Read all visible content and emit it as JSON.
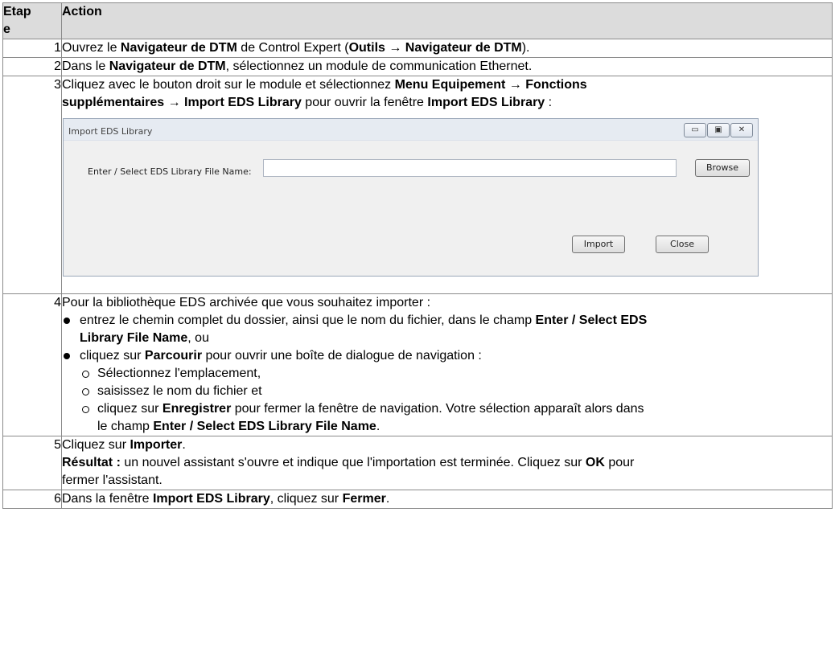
{
  "header": {
    "col1": "Etap",
    "col1b": "e",
    "col2": "Action"
  },
  "steps": [
    {
      "num": "1",
      "p1": "Ouvrez le ",
      "b1": "Navigateur de DTM",
      "p2": " de Control Expert (",
      "b2": "Outils → Navigateur de DTM",
      "p3": ")."
    },
    {
      "num": "2",
      "p1": "Dans le ",
      "b1": "Navigateur de DTM",
      "p2": ", sélectionnez un module de communication Ethernet."
    },
    {
      "num": "3",
      "p1": "Cliquez avec le bouton droit sur le module et sélectionnez ",
      "b1": "Menu Equipement → Fonctions",
      "b2": "supplémentaires → Import EDS Library",
      "p2": " pour ouvrir la fenêtre ",
      "b3": "Import EDS Library",
      "p3": " :"
    },
    {
      "num": "4",
      "intro": "Pour la bibliothèque EDS archivée que vous souhaitez importer :",
      "bul1_p1": "entrez le chemin complet du dossier, ainsi que le nom du fichier, dans le champ ",
      "bul1_b1": "Enter / Select EDS",
      "bul1_b2": "Library File Name",
      "bul1_p2": ", ou",
      "bul2_p1": "cliquez sur ",
      "bul2_b1": "Parcourir",
      "bul2_p2": " pour ouvrir une boîte de dialogue de navigation :",
      "sub1": "Sélectionnez l'emplacement,",
      "sub2": "saisissez le nom du fichier et",
      "sub3_p1": "cliquez sur ",
      "sub3_b1": "Enregistrer",
      "sub3_p2": " pour fermer la fenêtre de navigation. Votre sélection apparaît alors dans",
      "sub3_p3": "le champ ",
      "sub3_b2": "Enter / Select EDS Library File Name",
      "sub3_p4": "."
    },
    {
      "num": "5",
      "p1": "Cliquez sur ",
      "b1": "Importer",
      "p2": ".",
      "b2": "Résultat :",
      "p3": " un nouvel assistant s'ouvre et indique que l'importation est terminée. Cliquez sur ",
      "b3": "OK",
      "p4": " pour",
      "p5": "fermer l'assistant."
    },
    {
      "num": "6",
      "p1": "Dans la fenêtre ",
      "b1": "Import EDS Library",
      "p2": ", cliquez sur ",
      "b2": "Fermer",
      "p3": "."
    }
  ],
  "dialog": {
    "title": "Import EDS Library",
    "file_label": "Enter / Select EDS Library File Name:",
    "file_value": "",
    "browse_label": "Browse",
    "import_label": "Import",
    "close_label": "Close",
    "icons": [
      "minimize-icon",
      "maximize-icon",
      "close-icon"
    ]
  }
}
